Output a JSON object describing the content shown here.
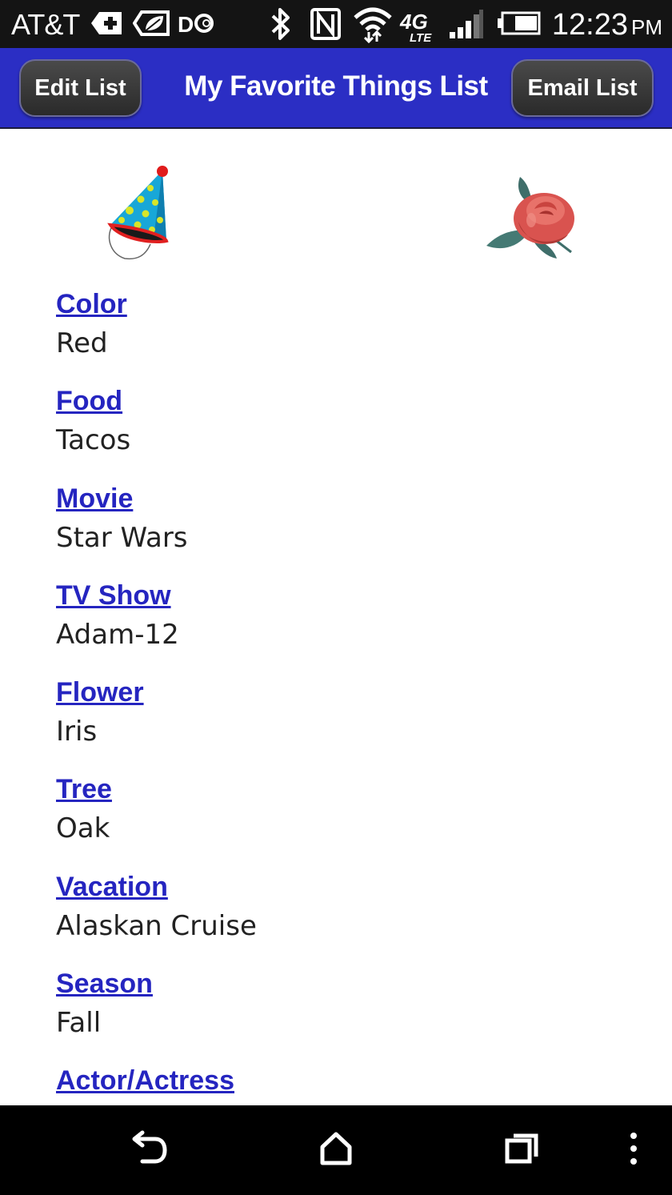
{
  "status_bar": {
    "carrier": "AT&T",
    "time": "12:23",
    "ampm": "PM",
    "icons": [
      "medical-plus-icon",
      "leaf-icon",
      "dc-icon",
      "bluetooth-icon",
      "nfc-icon",
      "wifi-icon",
      "4g-lte-icon",
      "signal-icon",
      "battery-icon"
    ]
  },
  "header": {
    "edit_label": "Edit List",
    "title": "My Favorite Things List",
    "email_label": "Email List"
  },
  "images": [
    "party-hat",
    "rose"
  ],
  "items": [
    {
      "label": "Color",
      "value": "Red"
    },
    {
      "label": "Food",
      "value": "Tacos"
    },
    {
      "label": "Movie",
      "value": "Star Wars"
    },
    {
      "label": "TV Show",
      "value": "Adam-12"
    },
    {
      "label": "Flower",
      "value": "Iris"
    },
    {
      "label": "Tree",
      "value": "Oak"
    },
    {
      "label": "Vacation",
      "value": "Alaskan Cruise"
    },
    {
      "label": "Season",
      "value": "Fall"
    },
    {
      "label": "Actor/Actress",
      "value": ""
    }
  ],
  "nav": [
    "back-icon",
    "home-icon",
    "recents-icon",
    "menu-icon"
  ],
  "colors": {
    "action_bar": "#2b2ec4",
    "link": "#2525c0",
    "status_bar": "#141414"
  }
}
